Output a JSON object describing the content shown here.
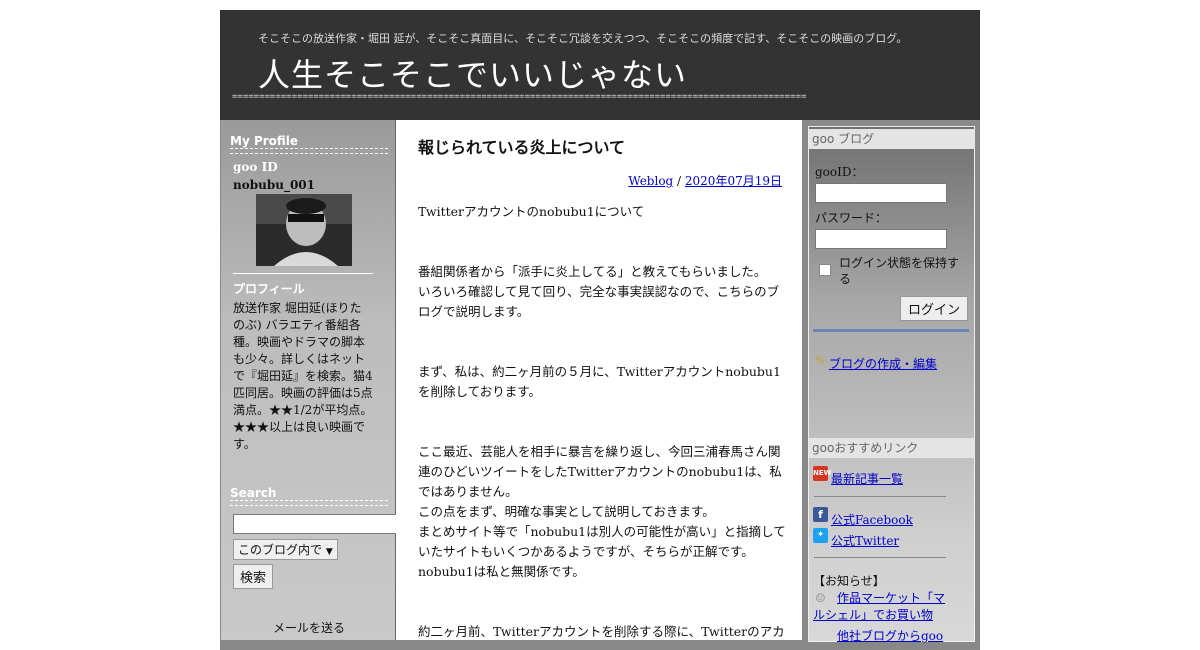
{
  "header": {
    "tagline": "そこそこの放送作家・堀田 延が、そこそこ真面目に、そこそこ冗談を交えつつ、そこそこの頻度で記す、そこそこの映画のブログ。",
    "title": "人生そこそこでいいじゃない",
    "rule": "=========================================================================================================="
  },
  "profile": {
    "heading": "My Profile",
    "id_label": "goo ID",
    "id_value": "nobubu_001",
    "prof_heading": "プロフィール",
    "prof_text": "放送作家 堀田延(ほりたのぶ) バラエティ番組各種。映画やドラマの脚本も少々。詳しくはネットで『堀田延』を検索。猫4匹同居。映画の評価は5点満点。★★1/2が平均点。★★★以上は良い映画です。"
  },
  "search": {
    "heading": "Search",
    "query": "",
    "scope_selected": "このブログ内で",
    "button": "検索"
  },
  "mail_link": "メールを送る",
  "post": {
    "title": "報じられている炎上について",
    "category": "Weblog",
    "date": "2020年07月19日",
    "paragraphs": [
      "Twitterアカウントのnobubu1について",
      "番組関係者から「派手に炎上してる」と教えてもらいました。\nいろいろ確認して見て回り、完全な事実誤認なので、こちらのブログで説明します。",
      "まず、私は、約二ヶ月前の５月に、Twitterアカウントnobubu1を削除しております。",
      "ここ最近、芸能人を相手に暴言を繰り返し、今回三浦春馬さん関連のひどいツイートをしたTwitterアカウントのnobubu1は、私ではありません。\nこの点をまず、明確な事実として説明しておきます。\nまとめサイト等で「nobubu1は別人の可能性が高い」と指摘していたサイトもいくつかあるようですが、そちらが正解です。\nnobubu1は私と無関係です。",
      "約二ヶ月前、Twitterアカウントを削除する際に、Twitterのアカ"
    ]
  },
  "login": {
    "heading": "goo ブログ",
    "id_label": "gooID：",
    "password_label": "パスワード：",
    "remember_label": "ログイン状態を保持する",
    "button": "ログイン",
    "create_link": "ブログの作成・編集"
  },
  "links": {
    "heading": "gooおすすめリンク",
    "latest": "最新記事一覧",
    "facebook": "公式Facebook",
    "twitter": "公式Twitter",
    "notice_heading": "【お知らせ】",
    "notice1": "作品マーケット「マルシェル」でお買い物",
    "notice2": "他社ブログからgoo"
  },
  "colors": {
    "header_bg": "#333333",
    "link": "#0000cc",
    "facebook": "#3b5998",
    "twitter": "#1da1f2",
    "new_badge": "#d9361f"
  }
}
